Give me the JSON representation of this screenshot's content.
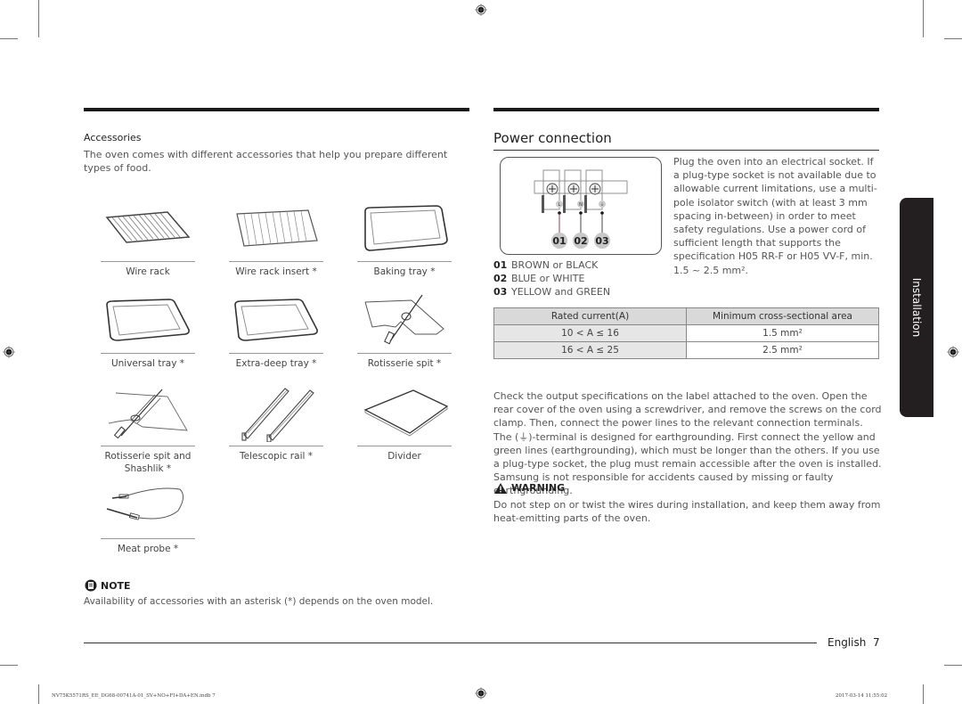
{
  "accessories": {
    "title": "Accessories",
    "intro": "The oven comes with different accessories that help you prepare different types of food.",
    "items": [
      {
        "label": "Wire rack",
        "icon": "wire-rack-icon"
      },
      {
        "label": "Wire rack insert *",
        "icon": "wire-rack-insert-icon"
      },
      {
        "label": "Baking tray *",
        "icon": "baking-tray-icon"
      },
      {
        "label": "Universal tray *",
        "icon": "universal-tray-icon"
      },
      {
        "label": "Extra-deep tray *",
        "icon": "extra-deep-tray-icon"
      },
      {
        "label": "Rotisserie spit *",
        "icon": "rotisserie-spit-icon"
      },
      {
        "label": "Rotisserie spit and Shashlik *",
        "icon": "rotisserie-shashlik-icon"
      },
      {
        "label": "Telescopic rail *",
        "icon": "telescopic-rail-icon"
      },
      {
        "label": "Divider",
        "icon": "divider-icon"
      },
      {
        "label": "Meat probe *",
        "icon": "meat-probe-icon"
      }
    ],
    "note": {
      "heading": "NOTE",
      "text": "Availability of accessories with an asterisk (*) depends on the oven model."
    }
  },
  "power": {
    "title": "Power connection",
    "diagram": {
      "terminals": [
        "L",
        "N",
        "⏚"
      ],
      "callouts": [
        "01",
        "02",
        "03"
      ]
    },
    "intro": "Plug the oven into an electrical socket. If a plug-type socket is not available due to allowable current limitations, use a multi-pole isolator switch (with at least 3 mm spacing in-between) in order to meet safety regulations. Use a power cord of sufficient length that supports the specification H05 RR-F or H05 VV-F, min. 1.5 ~ 2.5 mm².",
    "wires": [
      {
        "num": "01",
        "color": "BROWN or BLACK"
      },
      {
        "num": "02",
        "color": "BLUE or WHITE"
      },
      {
        "num": "03",
        "color": "YELLOW and GREEN"
      }
    ],
    "table": {
      "headers": [
        "Rated current(A)",
        "Minimum cross-sectional area"
      ],
      "rows": [
        [
          "10 < A ≤ 16",
          "1.5 mm²"
        ],
        [
          "16 < A ≤ 25",
          "2.5 mm²"
        ]
      ]
    },
    "body_pre": "Check the output specifications on the label attached to the oven. Open the rear cover of the oven using a screwdriver, and remove the screws on the cord clamp. Then, connect the power lines to the relevant connection terminals. The (",
    "body_symbol": "⏚",
    "body_post": ")-terminal is designed for earthgrounding. First connect the yellow and green lines (earthgrounding), which must be longer than the others. If you use a plug-type socket, the plug must remain accessible after the oven is installed. Samsung is not responsible for accidents caused by missing or faulty earthgrounding.",
    "warning": {
      "heading": "WARNING",
      "text": "Do not step on or twist the wires during installation, and keep them away from heat-emitting parts of the oven."
    }
  },
  "side_tab": "Installation",
  "footer": {
    "language": "English",
    "page": "7",
    "print_file": "NV75K5571RS_EE_DG68-00741A-01_SV+NO+FI+DA+EN.indb   7",
    "print_date": "2017-03-14   11:55:02"
  }
}
